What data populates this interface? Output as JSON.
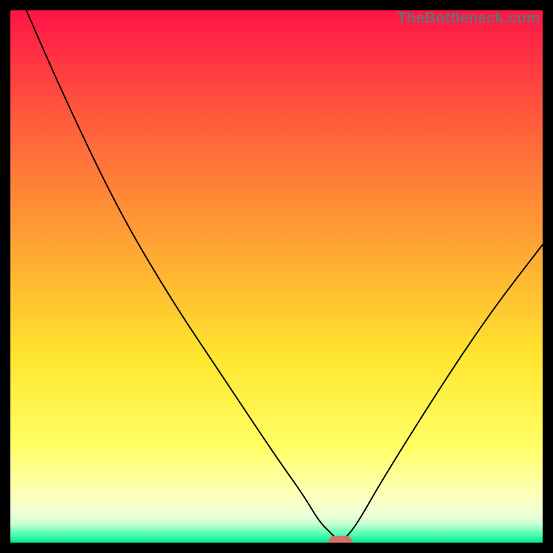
{
  "watermark": "TheBottleneck.com",
  "chart_data": {
    "type": "line",
    "title": "",
    "xlabel": "",
    "ylabel": "",
    "xlim": [
      0,
      100
    ],
    "ylim": [
      0,
      100
    ],
    "grid": false,
    "axes_visible": false,
    "series": [
      {
        "name": "bottleneck-curve",
        "x": [
          3,
          10,
          20,
          30,
          40,
          50,
          55,
          58,
          60,
          62,
          64,
          66,
          70,
          80,
          90,
          100
        ],
        "y": [
          100,
          84,
          63,
          46,
          31,
          16,
          9,
          4,
          2,
          0,
          2,
          5,
          12,
          28,
          43,
          56
        ],
        "stroke": "#000000",
        "stroke_width": 2
      }
    ],
    "marker": {
      "x": 62,
      "y": 0,
      "width": 4.5,
      "height": 2.6,
      "rx": 1.3,
      "fill": "#d8736a"
    },
    "gradient_stops": [
      {
        "offset": 0.0,
        "color": "#ff1447"
      },
      {
        "offset": 0.2,
        "color": "#ff5a3c"
      },
      {
        "offset": 0.45,
        "color": "#ffa733"
      },
      {
        "offset": 0.65,
        "color": "#ffe52e"
      },
      {
        "offset": 0.82,
        "color": "#ffff66"
      },
      {
        "offset": 0.9,
        "color": "#ffffb0"
      },
      {
        "offset": 0.945,
        "color": "#f1ffd8"
      },
      {
        "offset": 0.965,
        "color": "#c8ffd0"
      },
      {
        "offset": 0.985,
        "color": "#4dffb0"
      },
      {
        "offset": 1.0,
        "color": "#00e888"
      }
    ]
  }
}
